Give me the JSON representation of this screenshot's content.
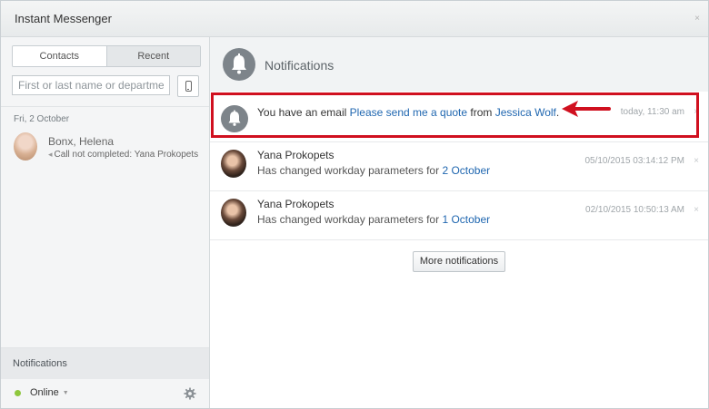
{
  "window": {
    "title": "Instant Messenger",
    "close_glyph": "×"
  },
  "left": {
    "tabs": [
      {
        "label": "Contacts"
      },
      {
        "label": "Recent"
      }
    ],
    "search_placeholder": "First or last name or department",
    "phone_button_icon": "mobile-phone-icon",
    "recent": {
      "date_header": "Fri, 2 October",
      "contact": {
        "name": "Bonx, Helena",
        "status_icon": "call-arrow-icon",
        "status": "Call not completed: Yana Prokopets"
      }
    },
    "notifications_label": "Notifications",
    "status": {
      "label": "Online",
      "caret": "▼",
      "dot_color": "#8ec73d"
    },
    "settings_icon": "gear-icon"
  },
  "right": {
    "header_title": "Notifications",
    "header_icon": "bell-icon",
    "items": [
      {
        "icon": "bell-icon",
        "prefix": "You have an email ",
        "link1": "Please send me a quote",
        "middle": " from ",
        "link2": "Jessica Wolf",
        "suffix": ".",
        "time": "today, 11:30 am",
        "close": "×"
      },
      {
        "name": "Yana Prokopets",
        "text": "Has changed workday parameters for ",
        "link": "2 October",
        "time": "05/10/2015 03:14:12 PM",
        "close": "×"
      },
      {
        "name": "Yana Prokopets",
        "text": "Has changed workday parameters for ",
        "link": "1 October",
        "time": "02/10/2015 10:50:13 AM",
        "close": "×"
      }
    ],
    "more_button": "More notifications"
  },
  "annotation": {
    "highlight_color": "#d0101f"
  }
}
